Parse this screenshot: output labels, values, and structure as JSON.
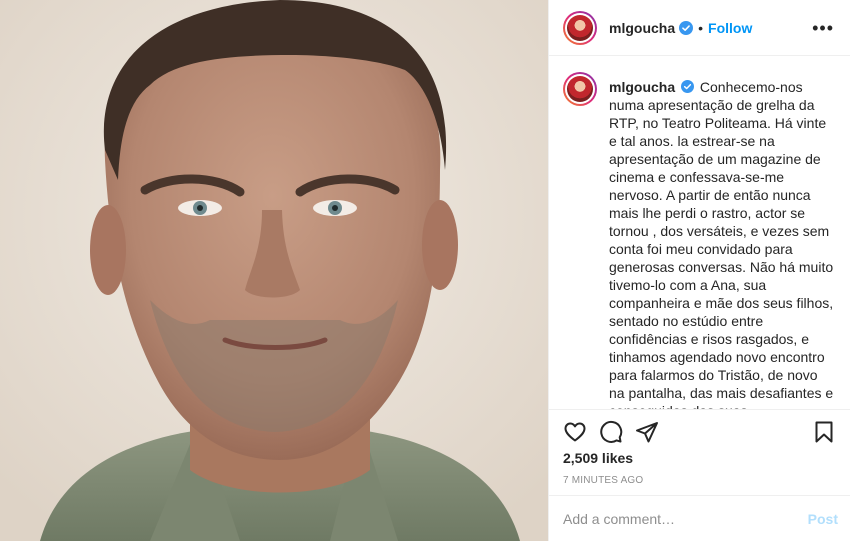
{
  "post": {
    "username": "mlgoucha",
    "follow_label": "Follow",
    "separator": "•",
    "more_label": "•••",
    "caption": "Conhecemo-nos numa apresentação de grelha da RTP, no Teatro Politeama. Há vinte e tal anos. la estrear-se na apresentação de um magazine de cinema e confessava-se-me nervoso. A partir de então nunca mais lhe perdi o rastro, actor se tornou , dos versáteis, e vezes sem conta foi meu convidado para generosas conversas. Não há muito tivemo-lo com a Ana, sua companheira e mãe dos seus filhos, sentado no estúdio entre confidências e risos rasgados, e tinhamos agendado novo encontro para falarmos do Tristão, de novo na pantalha, das mais desafiantes e conseguidas das suas personagens. \"Sou seu fã\", era o que dizíamos sempre um ao outro, quando éramos juntos, como se fora um código entre",
    "likes": "2,509 likes",
    "time_ago": "7 MINUTES AGO",
    "comment_placeholder": "Add a comment…",
    "post_label": "Post"
  },
  "colors": {
    "accent": "#0095f6",
    "post_disabled": "#b2dffc",
    "verified": "#3897f0"
  },
  "icons": [
    "heart-icon",
    "comment-icon",
    "share-icon",
    "bookmark-icon",
    "verified-badge-icon"
  ]
}
